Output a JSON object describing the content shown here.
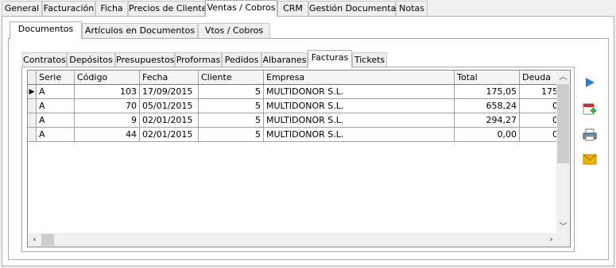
{
  "top_tabs": [
    {
      "label": "General"
    },
    {
      "label": "Facturación"
    },
    {
      "label": "Ficha"
    },
    {
      "label": "Precios de Cliente"
    },
    {
      "label": "Ventas / Cobros"
    },
    {
      "label": "CRM"
    },
    {
      "label": "Gestión Documental"
    },
    {
      "label": "Notas"
    }
  ],
  "second_tabs": [
    {
      "label": "Documentos"
    },
    {
      "label": "Artículos en Documentos"
    },
    {
      "label": "Vtos / Cobros"
    }
  ],
  "doc_tabs": [
    {
      "label": "Contratos"
    },
    {
      "label": "Depósitos"
    },
    {
      "label": "Presupuestos"
    },
    {
      "label": "Proformas"
    },
    {
      "label": "Pedidos"
    },
    {
      "label": "Albaranes"
    },
    {
      "label": "Facturas"
    },
    {
      "label": "Tickets"
    }
  ],
  "grid": {
    "columns": [
      "Serie",
      "Código",
      "Fecha",
      "Cliente",
      "Empresa",
      "Total",
      "Deuda"
    ],
    "rows": [
      [
        "A",
        "103",
        "17/09/2015",
        "5",
        "MULTIDONOR S.L.",
        "175,05",
        "175"
      ],
      [
        "A",
        "70",
        "05/01/2015",
        "5",
        "MULTIDONOR S.L.",
        "658,24",
        "0"
      ],
      [
        "A",
        "9",
        "02/01/2015",
        "5",
        "MULTIDONOR S.L.",
        "294,27",
        "0"
      ],
      [
        "A",
        "44",
        "02/01/2015",
        "5",
        "MULTIDONOR S.L.",
        "0,00",
        "0"
      ]
    ]
  },
  "side_icons": [
    "play-icon",
    "calendar-add-icon",
    "printer-icon",
    "email-icon"
  ],
  "colors": {
    "selected_tab": "#ffffff",
    "play": "#2a7fd4",
    "calendar_red": "#d42a2a",
    "email": "#f0b400"
  }
}
